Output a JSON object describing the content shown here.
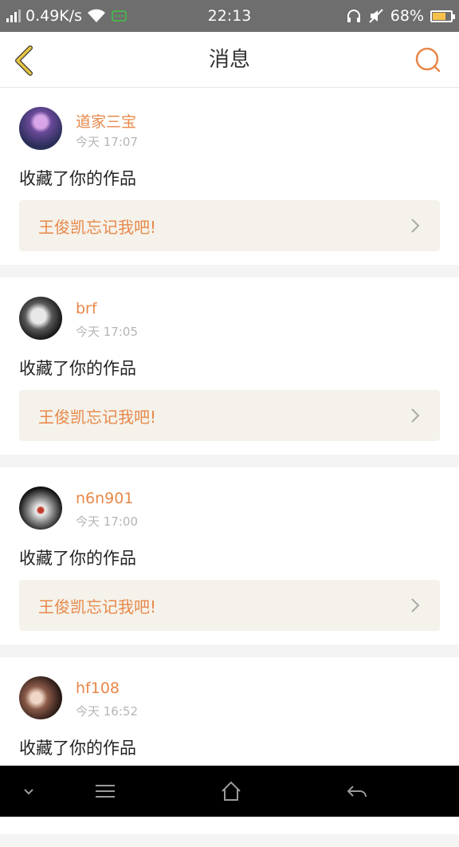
{
  "status_bar": {
    "speed": "0.49K/s",
    "time": "22:13",
    "battery": "68%"
  },
  "header": {
    "title": "消息"
  },
  "messages": [
    {
      "username": "道家三宝",
      "time": "今天 17:07",
      "action": "收藏了你的作品",
      "work_title": "王俊凯忘记我吧!"
    },
    {
      "username": "brf",
      "time": "今天 17:05",
      "action": "收藏了你的作品",
      "work_title": "王俊凯忘记我吧!"
    },
    {
      "username": "n6n901",
      "time": "今天 17:00",
      "action": "收藏了你的作品",
      "work_title": "王俊凯忘记我吧!"
    },
    {
      "username": "hf108",
      "time": "今天 16:52",
      "action": "收藏了你的作品",
      "work_title": ""
    }
  ],
  "colors": {
    "accent": "#e8884a",
    "back_icon": "#e6c640",
    "card_bg": "#f4f2ea"
  },
  "icons": [
    "signal-icon",
    "wifi-icon",
    "chat-notification-icon",
    "headphone-icon",
    "mute-icon",
    "battery-icon",
    "back-arrow-icon",
    "search-icon",
    "chevron-right-icon",
    "collapse-icon",
    "menu-icon",
    "home-icon",
    "return-icon"
  ]
}
